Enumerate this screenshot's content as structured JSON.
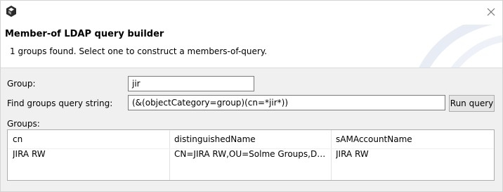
{
  "header": {
    "title": "Member-of LDAP query builder",
    "subtitle": "1 groups found. Select one to construct a members-of-query."
  },
  "icons": {
    "app": "app-icon",
    "close": "close-icon"
  },
  "form": {
    "group_label": "Group:",
    "group_value": "jir",
    "query_label": "Find groups query string:",
    "query_value": "(&(objectCategory=group)(cn=*jir*))",
    "run_query_label": "Run query",
    "groups_label": "Groups:"
  },
  "table": {
    "columns": [
      "cn",
      "distinguishedName",
      "sAMAccountName"
    ],
    "rows": [
      {
        "cn": "JIRA RW",
        "distinguishedName": "CN=JIRA RW,OU=Solme Groups,DC=s...",
        "sAMAccountName": "JIRA RW"
      }
    ]
  },
  "colors": {
    "accent": "#000000",
    "window_bg": "#f0f0f0",
    "header_bg": "#ffffff"
  }
}
